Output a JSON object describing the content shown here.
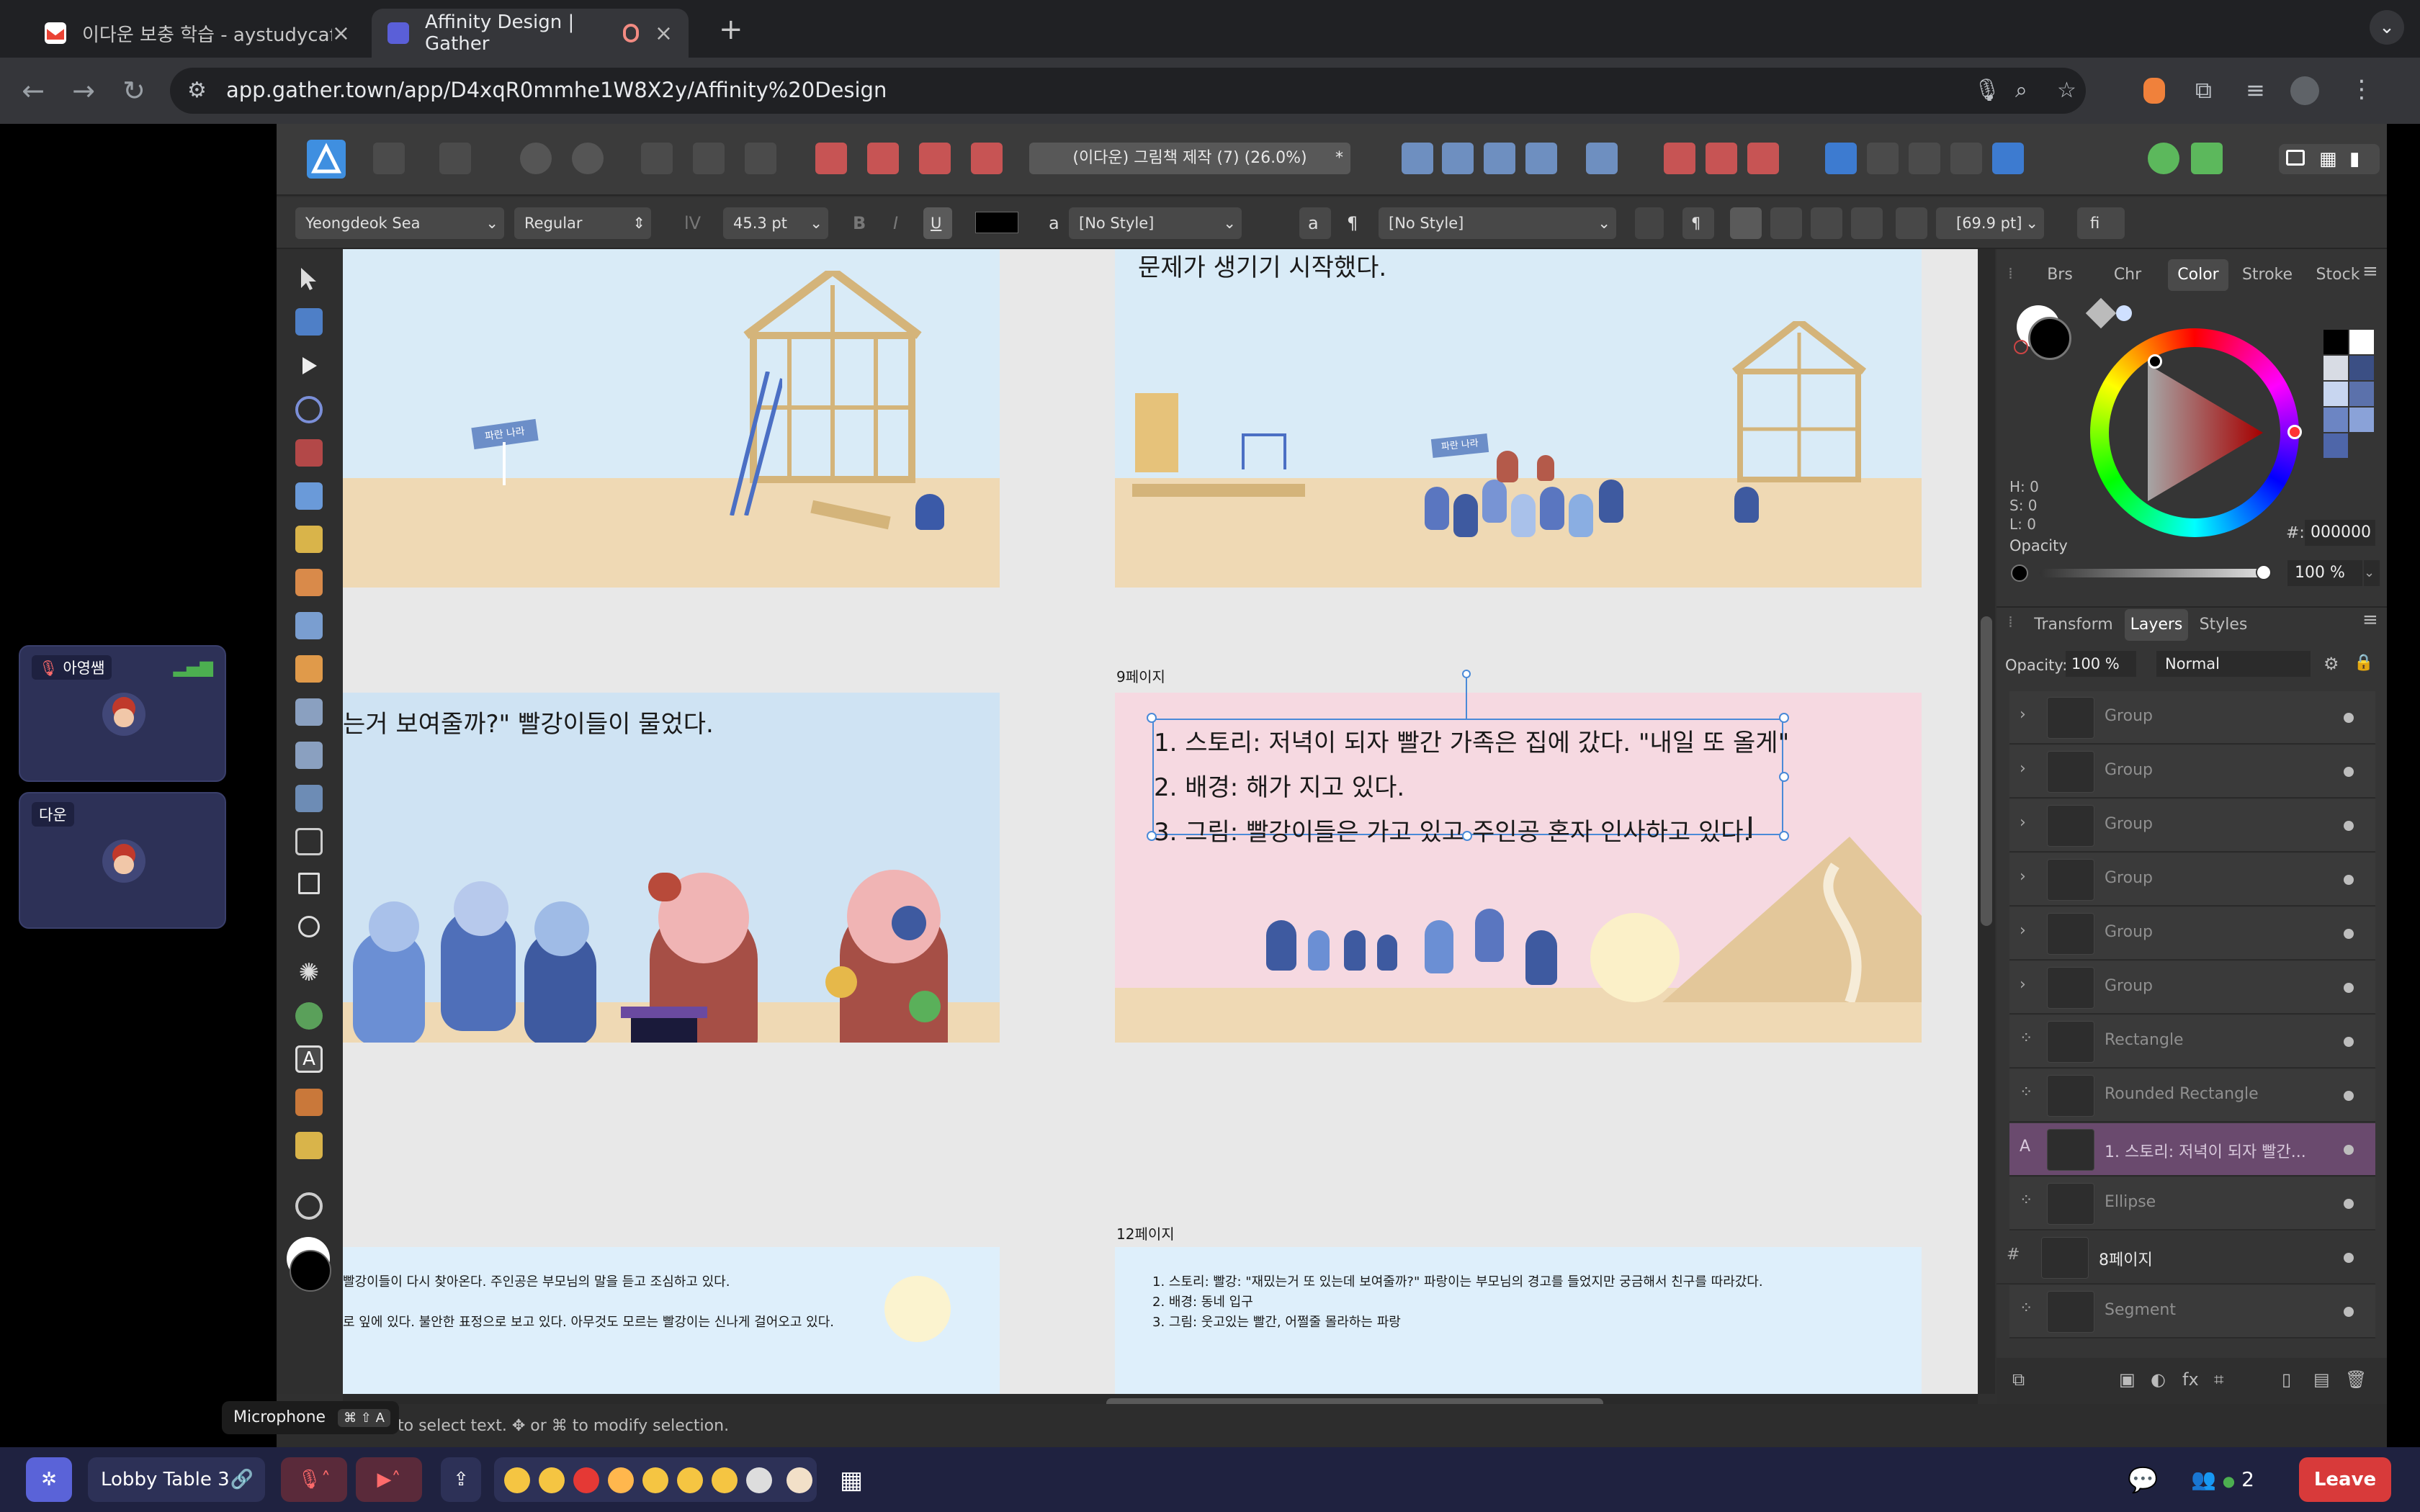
{
  "browser": {
    "tabs": [
      {
        "title": "이다운 보충 학습 - aystudycafe@",
        "active": false
      },
      {
        "title": "Affinity Design | Gather",
        "active": true
      }
    ],
    "url": "app.gather.town/app/D4xqR0mmhe1W8X2y/Affinity%20Design"
  },
  "affinity": {
    "doc_title": "(이다운) 그림책 제작 (7) (26.0%)",
    "context": {
      "font": "Yeongdeok Sea",
      "weight": "Regular",
      "size": "45.3 pt",
      "char_style": "[No Style]",
      "para_style": "[No Style]",
      "leading": "[69.9 pt]",
      "bold": "B",
      "italic": "I",
      "underline": "U",
      "a_label": "a",
      "pilcrow": "¶",
      "fi": "fi"
    },
    "panel_tabs_top": [
      "Brs",
      "Chr",
      "Color",
      "Stroke",
      "Stock"
    ],
    "color": {
      "h": "H: 0",
      "s": "S: 0",
      "l": "L: 0",
      "opacity_label": "Opacity",
      "hex_label": "#:",
      "hex": "000000",
      "opacity": "100 %"
    },
    "panel_tabs_bottom": [
      "Transform",
      "Layers",
      "Styles"
    ],
    "layers_opacity_label": "Opacity:",
    "layers_opacity": "100 %",
    "blend": "Normal",
    "layers": [
      {
        "name": "Group",
        "type": "group"
      },
      {
        "name": "Group",
        "type": "group"
      },
      {
        "name": "Group",
        "type": "group"
      },
      {
        "name": "Group",
        "type": "group"
      },
      {
        "name": "Group",
        "type": "group"
      },
      {
        "name": "Group",
        "type": "group"
      },
      {
        "name": "Rectangle",
        "type": "shape"
      },
      {
        "name": "Rounded Rectangle",
        "type": "shape"
      },
      {
        "name": "1. 스토리: 저녁이 되자 빨간...",
        "type": "text",
        "selected": true
      },
      {
        "name": "Ellipse",
        "type": "shape"
      },
      {
        "name": "8페이지",
        "type": "artboard"
      },
      {
        "name": "Segment",
        "type": "shape"
      }
    ],
    "status": "to select text. ✥ or ⌘ to modify selection.",
    "canvas": {
      "top_right_text": "문제가 생기기 시작했다.",
      "sign1": "파란 나라",
      "sign2": "파란 나라",
      "mid_left_text": "는거 보여줄까?\" 빨강이들이 물었다.",
      "page9_label": "9페이지",
      "page9_lines": [
        "1. 스토리: 저녁이 되자 빨간 가족은 집에 갔다. \"내일 또 올게\"",
        "2. 배경: 해가 지고 있다.",
        "3. 그림: 빨강이들은 가고 있고 주인공 혼자 인사하고 있다."
      ],
      "page12_label": "12페이지",
      "page12_lines": [
        "1. 스토리: 빨강: \"재밌는거 또 있는데 보여줄까?\" 파랑이는 부모님의 경고를 들었지만 궁금해서 친구를 따라갔다.",
        "2. 배경: 동네 입구",
        "3. 그림: 웃고있는 빨간, 어쩔줄 몰라하는 파랑"
      ],
      "bottom_left_lines": [
        "빨강이들이 다시 찾아온다. 주인공은 부모님의 말을 듣고 조심하고 있다.",
        "로 잎에 있다. 불안한 표정으로 보고 있다. 아무것도 모르는 빨강이는 신나게 걸어오고 있다."
      ]
    }
  },
  "gather": {
    "participants": [
      {
        "name": "아영쌤"
      },
      {
        "name": "다운"
      }
    ],
    "tooltip": "Microphone",
    "tooltip_keys": "⌘ ⇧ A",
    "room": "Lobby Table 3",
    "people_count": "2",
    "leave": "Leave"
  },
  "colors": {
    "accent_layer": "#6a4a6e",
    "leave": "#d83a3a",
    "gather_bar": "#1f2240",
    "sky": "#d9ebf7",
    "pink": "#f6d9e1"
  }
}
